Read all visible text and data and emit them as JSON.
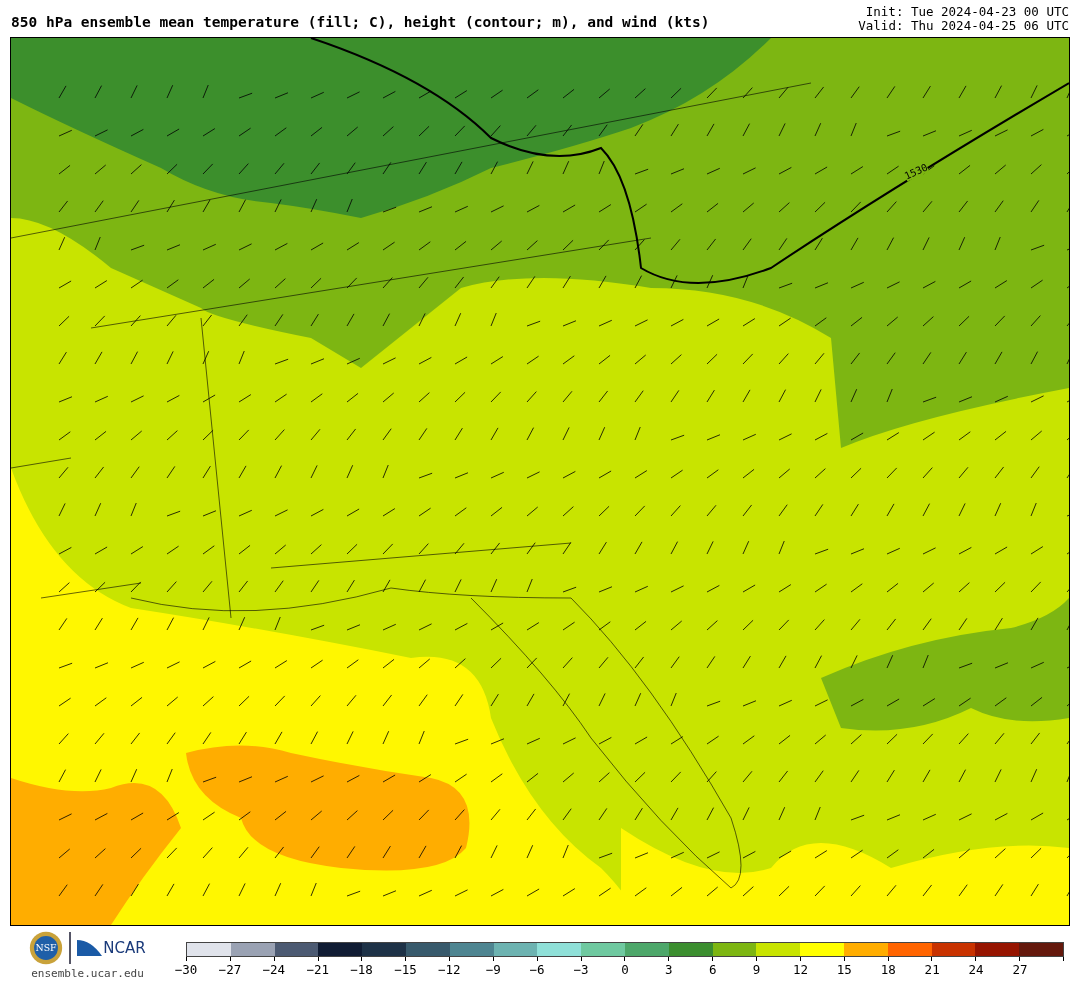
{
  "header": {
    "title": "850 hPa ensemble mean temperature (fill; C), height (contour; m), and wind (kts)",
    "init": "Init: Tue 2024-04-23 00 UTC",
    "valid": "Valid: Thu 2024-04-25 06 UTC"
  },
  "map": {
    "contour_label": "1530"
  },
  "footer": {
    "ncar": "NCAR",
    "nsf": "NSF",
    "url": "ensemble.ucar.edu"
  },
  "colorbar": {
    "bins": [
      {
        "color": "#e0e3eb"
      },
      {
        "color": "#9aa2b3"
      },
      {
        "color": "#4c5a72"
      },
      {
        "color": "#101c33"
      },
      {
        "color": "#1e3247"
      },
      {
        "color": "#385a6c"
      },
      {
        "color": "#4e8591"
      },
      {
        "color": "#6db3b1"
      },
      {
        "color": "#8fe0d8"
      },
      {
        "color": "#6fc9a0"
      },
      {
        "color": "#4da76a"
      },
      {
        "color": "#3b8e2f"
      },
      {
        "color": "#7db612"
      },
      {
        "color": "#c8e400"
      },
      {
        "color": "#ffff00"
      },
      {
        "color": "#ffad00"
      },
      {
        "color": "#ff6400"
      },
      {
        "color": "#c83200"
      },
      {
        "color": "#961400"
      },
      {
        "color": "#64180c"
      }
    ],
    "ticks": [
      "−30",
      "−27",
      "−24",
      "−21",
      "−18",
      "−15",
      "−12",
      "−9",
      "−6",
      "−3",
      "0",
      "3",
      "6",
      "9",
      "12",
      "15",
      "18",
      "21",
      "24",
      "27"
    ]
  }
}
